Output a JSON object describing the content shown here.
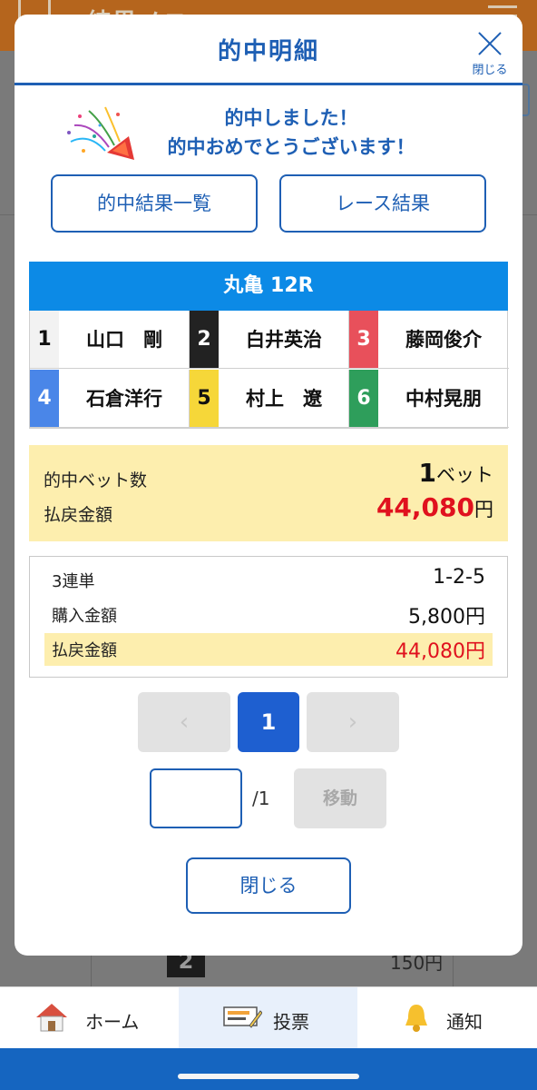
{
  "background": {
    "header_title": "結果メニ",
    "row_number": "2",
    "row_price": "150円"
  },
  "modal": {
    "title": "的中明細",
    "close_label": "閉じる",
    "congrats_line1": "的中しました！",
    "congrats_line2": "的中おめでとうございます！",
    "hit_list_button": "的中結果一覧",
    "race_result_button": "レース結果",
    "race_title": "丸亀 12R",
    "racers": [
      {
        "num": "1",
        "name": "山口　剛",
        "bg": "#f2f2f2",
        "fg": "#111111"
      },
      {
        "num": "2",
        "name": "白井英治",
        "bg": "#222222",
        "fg": "#ffffff"
      },
      {
        "num": "3",
        "name": "藤岡俊介",
        "bg": "#e8505b",
        "fg": "#ffffff"
      },
      {
        "num": "4",
        "name": "石倉洋行",
        "bg": "#4a86e8",
        "fg": "#ffffff"
      },
      {
        "num": "5",
        "name": "村上　遼",
        "bg": "#f6d739",
        "fg": "#111111"
      },
      {
        "num": "6",
        "name": "中村晃朋",
        "bg": "#2e9e5b",
        "fg": "#ffffff"
      }
    ],
    "summary": {
      "bet_count_label": "的中ベット数",
      "bet_count_value": "1",
      "bet_count_unit": "ベット",
      "payout_label": "払戻金額",
      "payout_value": "44,080",
      "payout_unit": "円"
    },
    "detail": {
      "bet_type_label": "3連単",
      "bet_type_value": "1-2-5",
      "purchase_label": "購入金額",
      "purchase_value": "5,800円",
      "payout_label": "払戻金額",
      "payout_value": "44,080円"
    },
    "pager": {
      "prev": "‹",
      "current": "1",
      "next": "›",
      "input_value": "",
      "total": "/1",
      "move_button": "移動"
    },
    "close_button": "閉じる"
  },
  "nav": {
    "home": "ホーム",
    "vote": "投票",
    "notify": "通知"
  },
  "colors": {
    "accent": "#1e5fb4",
    "race_header": "#0c8ae6",
    "highlight": "#fdeeae",
    "payout_red": "#e0111e"
  }
}
